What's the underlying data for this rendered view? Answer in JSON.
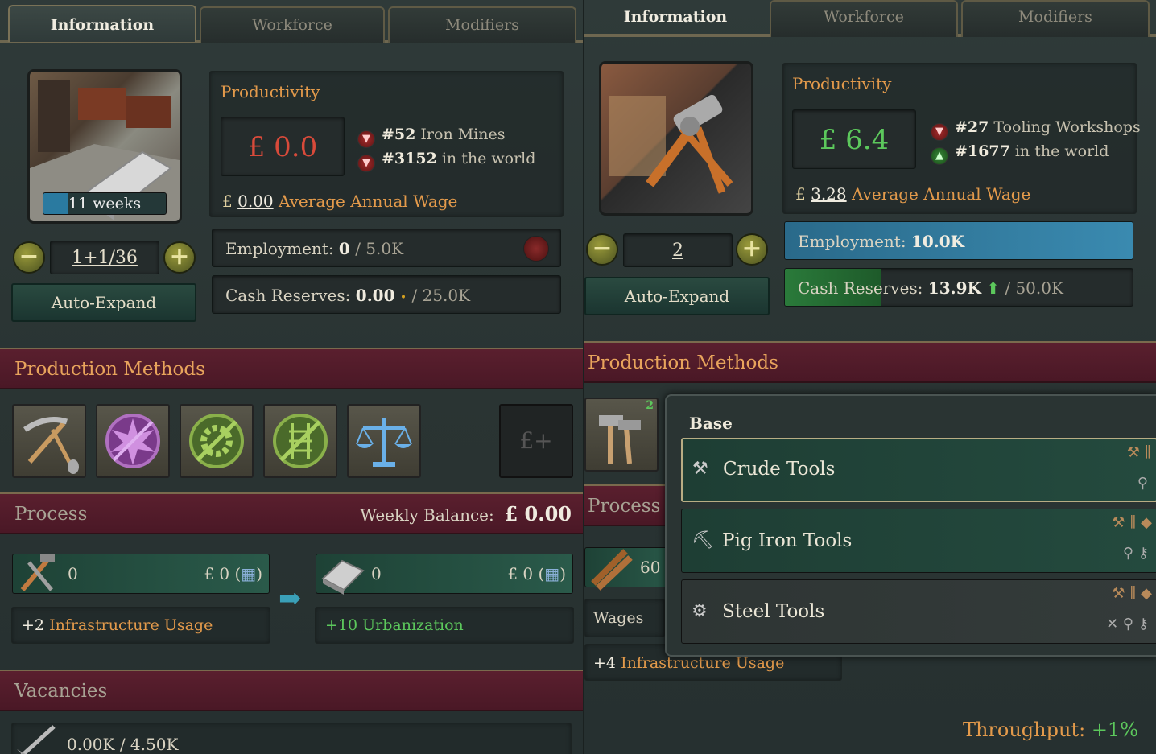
{
  "left": {
    "tabs": [
      "Information",
      "Workforce",
      "Modifiers"
    ],
    "construction_time": "11 weeks",
    "level": "1+1/36",
    "auto_expand": "Auto-Expand",
    "productivity_label": "Productivity",
    "productivity_value": "£ 0.0",
    "rank_type": "#52",
    "rank_type_label": "Iron Mines",
    "rank_world": "#3152",
    "rank_world_label": "in the world",
    "wage_currency": "£",
    "wage_value": "0.00",
    "wage_label": "Average Annual Wage",
    "employment_label": "Employment:",
    "employment_value": "0",
    "employment_max": "/ 5.0K",
    "cash_label": "Cash Reserves:",
    "cash_value": "0.00",
    "cash_max": "/ 25.0K",
    "pm_header": "Production Methods",
    "process_header": "Process",
    "weekly_balance_label": "Weekly Balance:",
    "weekly_balance_value": "£ 0.00",
    "input_amount": "0",
    "input_cost": "£ 0 (",
    "input_cost_end": ")",
    "output_amount": "0",
    "output_cost": "£ 0 (",
    "output_cost_end": ")",
    "infra_value": "+2",
    "infra_label": "Infrastructure Usage",
    "urban_label": "+10 Urbanization",
    "vacancies_header": "Vacancies",
    "vacancies_value": "0.00K / 4.50K",
    "sub_button": "£+"
  },
  "right": {
    "tabs": [
      "Information",
      "Workforce",
      "Modifiers"
    ],
    "level": "2",
    "auto_expand": "Auto-Expand",
    "productivity_label": "Productivity",
    "productivity_value": "£ 6.4",
    "rank_type": "#27",
    "rank_type_label": "Tooling Workshops",
    "rank_world": "#1677",
    "rank_world_label": "in the world",
    "wage_currency": "£",
    "wage_value": "3.28",
    "wage_label": "Average Annual Wage",
    "employment_label": "Employment:",
    "employment_value": "10.0K",
    "employment_fill": 1.0,
    "cash_label": "Cash Reserves:",
    "cash_value": "13.9K",
    "cash_max": "/ 50.0K",
    "cash_fill": 0.278,
    "pm_header": "Production Methods",
    "pm_badge": "2",
    "process_header": "Process",
    "input_amount": "60",
    "wages_label": "Wages",
    "infra_value": "+4",
    "infra_label": "Infrastructure Usage",
    "throughput_label": "Throughput:",
    "throughput_value": "+1%",
    "dropdown": {
      "title": "Base",
      "options": [
        {
          "label": "Crude Tools",
          "selected": true
        },
        {
          "label": "Pig Iron Tools",
          "selected": false
        },
        {
          "label": "Steel Tools",
          "selected": false
        }
      ]
    }
  },
  "colors": {
    "accent_orange": "#e39a4b",
    "positive_green": "#5cc85c",
    "negative_red": "#d84a3a",
    "header_maroon": "#5a1f2e"
  }
}
